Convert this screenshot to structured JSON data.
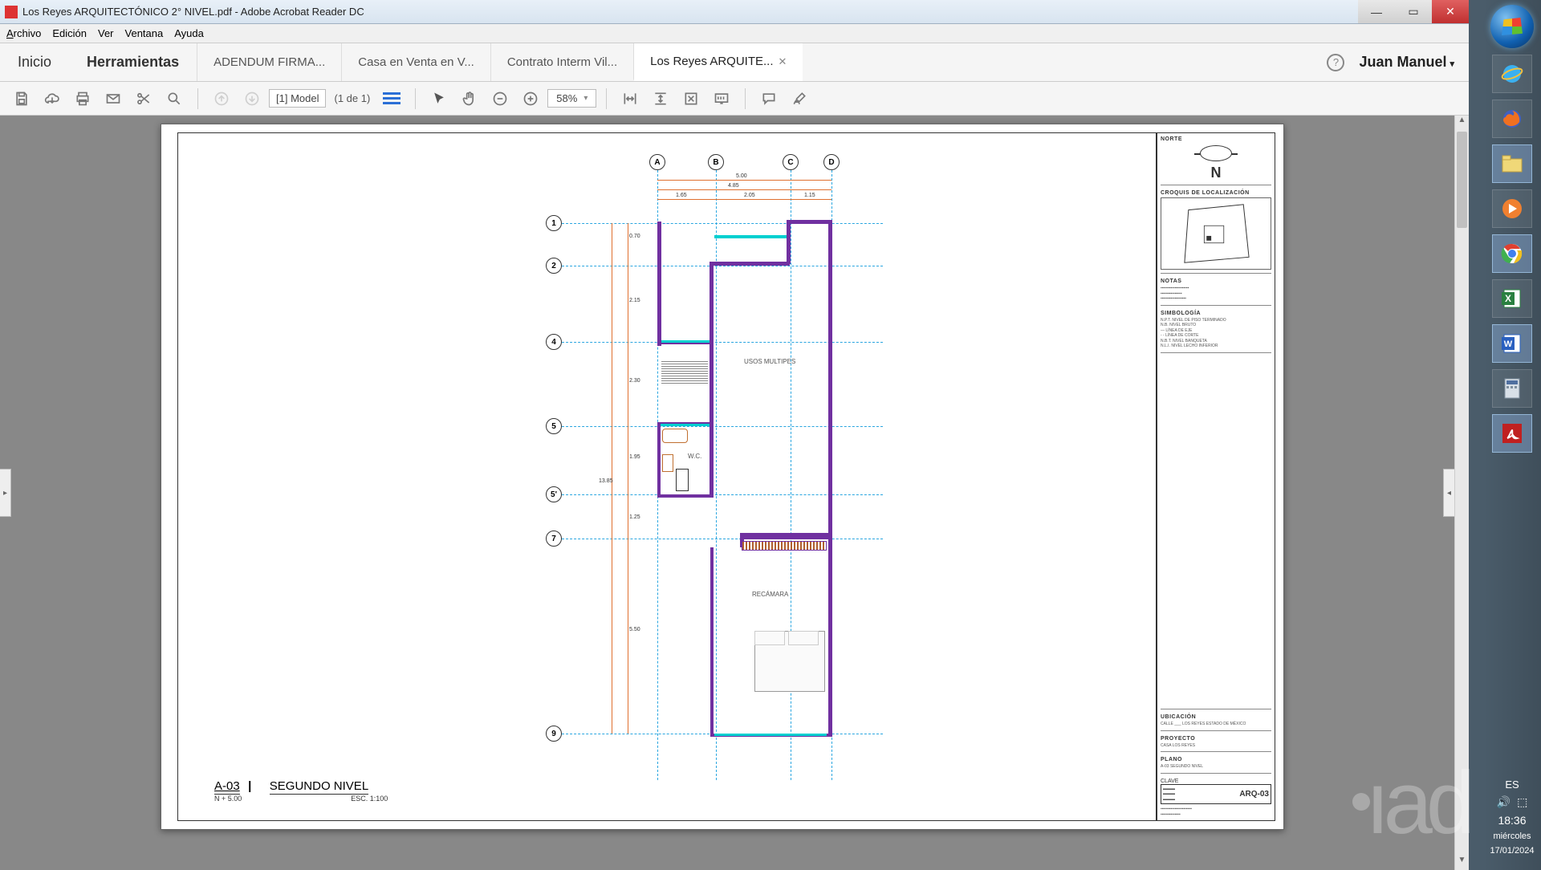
{
  "window": {
    "title": "Los Reyes ARQUITECTÓNICO 2° NIVEL.pdf - Adobe Acrobat Reader DC"
  },
  "menu": {
    "archivo": "Archivo",
    "edicion": "Edición",
    "ver": "Ver",
    "ventana": "Ventana",
    "ayuda": "Ayuda"
  },
  "maintabs": {
    "inicio": "Inicio",
    "herramientas": "Herramientas"
  },
  "doctabs": [
    {
      "label": "ADENDUM FIRMA...",
      "active": false
    },
    {
      "label": "Casa en Venta en V...",
      "active": false
    },
    {
      "label": "Contrato Interm Vil...",
      "active": false
    },
    {
      "label": "Los Reyes ARQUITE...",
      "active": true
    }
  ],
  "user": {
    "name": "Juan Manuel"
  },
  "toolbar": {
    "page_label": "[1] Model",
    "page_of": "(1 de 1)",
    "zoom": "58%"
  },
  "plan": {
    "code": "A-03",
    "name": "SEGUNDO NIVEL",
    "level_note": "N + 5.00",
    "scale": "ESC. 1:100",
    "grid_cols": [
      "A",
      "B",
      "C",
      "D"
    ],
    "grid_rows": [
      "1",
      "2",
      "4",
      "5",
      "5'",
      "7",
      "9"
    ],
    "dims_top": {
      "total": "5.00",
      "sub": "4.85",
      "a": "1.65",
      "b": "2.05",
      "c": "1.15"
    },
    "dims_left": {
      "r1": "0.70",
      "r2": "2.15",
      "r3": "2.30",
      "r4": "1.95",
      "r5": "1.25",
      "r6": "5.50",
      "total": "13.85"
    },
    "rooms": {
      "usos": "USOS MULTIPES",
      "wc": "W.C.",
      "recamara": "RECÁMARA"
    }
  },
  "titleblock": {
    "north_label": "NORTE",
    "north_letter": "N",
    "croquis_hdr": "CROQUIS DE LOCALIZACIÓN",
    "notas_hdr": "NOTAS",
    "simbologia_hdr": "SIMBOLOGÍA",
    "ubicacion_hdr": "UBICACIÓN",
    "ubicacion_txt": "CALLE ___ LOS REYES ESTADO DE MÉXICO",
    "proyecto_hdr": "PROYECTO",
    "proyecto_txt": "CASA LOS REYES",
    "plano_hdr": "PLANO",
    "plano_txt": "A-03 SEGUNDO NIVEL",
    "clave_hdr": "CLAVE",
    "clave_num": "ARQ-03"
  },
  "tray": {
    "lang": "ES",
    "time": "18:36",
    "day": "miércoles",
    "date": "17/01/2024"
  }
}
